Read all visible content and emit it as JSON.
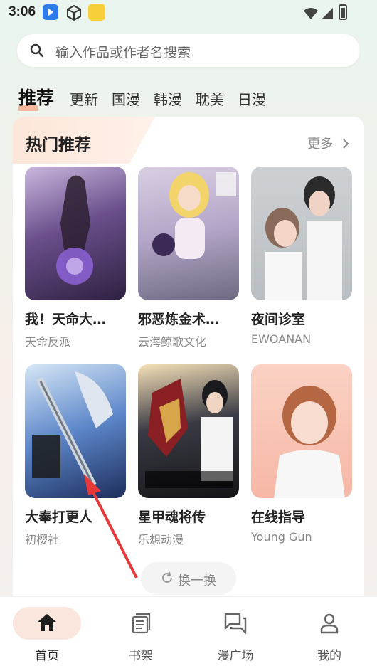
{
  "status_bar": {
    "time": "3:06"
  },
  "search": {
    "placeholder": "输入作品或作者名搜索"
  },
  "tabs": [
    {
      "label": "推荐",
      "active": true
    },
    {
      "label": "更新"
    },
    {
      "label": "国漫"
    },
    {
      "label": "韩漫"
    },
    {
      "label": "耽美"
    },
    {
      "label": "日漫"
    }
  ],
  "section": {
    "title": "热门推荐",
    "more_label": "更多",
    "swap_label": "换一换",
    "items": [
      {
        "title": "我！天命大…",
        "author": "天命反派"
      },
      {
        "title": "邪恶炼金术…",
        "author": "云海鲸歌文化"
      },
      {
        "title": "夜间诊室",
        "author": "EWOANAN"
      },
      {
        "title": "大奉打更人",
        "author": "初樱社"
      },
      {
        "title": "星甲魂将传",
        "author": "乐想动漫"
      },
      {
        "title": "在线指导",
        "author": "Young Gun"
      }
    ]
  },
  "nav": [
    {
      "label": "首页",
      "icon": "home-icon",
      "active": true
    },
    {
      "label": "书架",
      "icon": "bookshelf-icon"
    },
    {
      "label": "漫广场",
      "icon": "chat-square-icon"
    },
    {
      "label": "我的",
      "icon": "profile-icon"
    }
  ],
  "colors": {
    "accent": "#f3a07d",
    "arrow": "#e8393a",
    "nav_active_bg": "#fbe6dd"
  }
}
